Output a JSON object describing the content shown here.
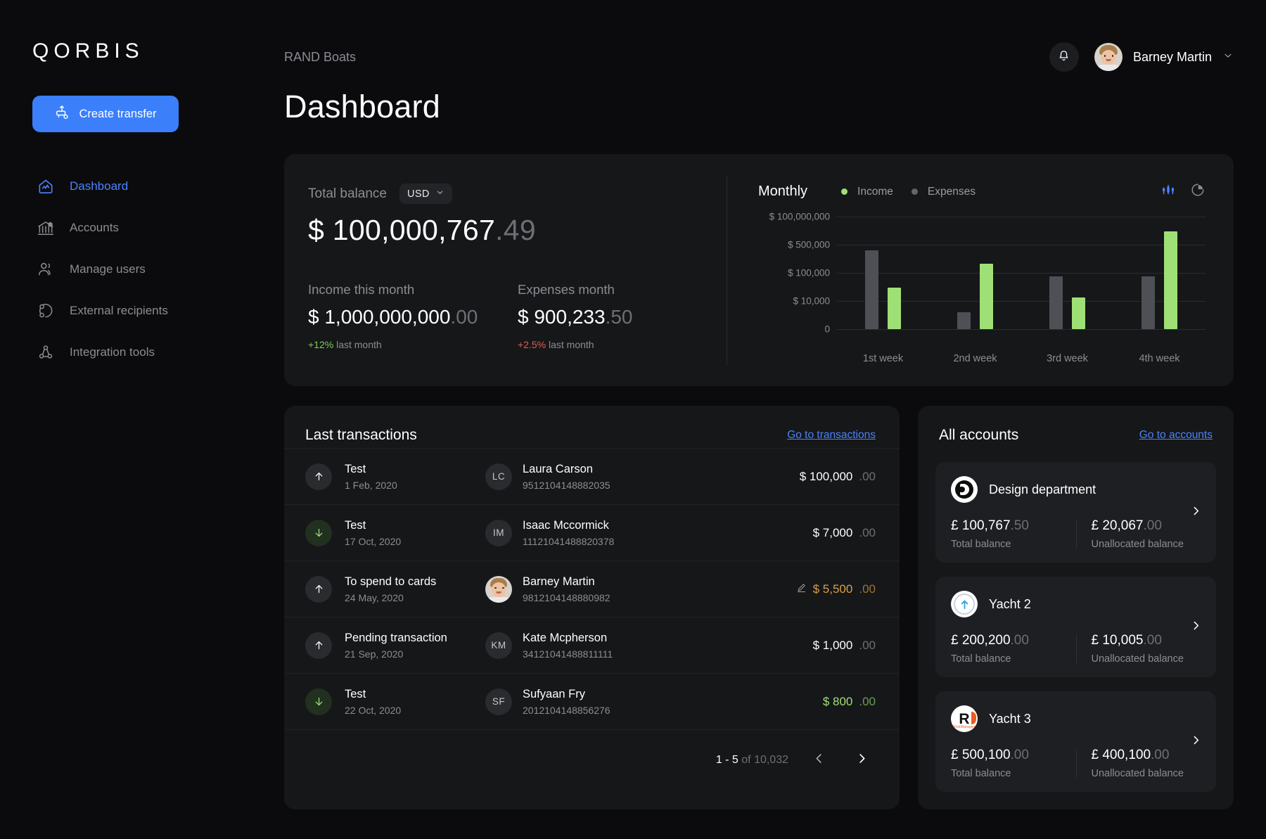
{
  "brand": {
    "logo": "QORBIS"
  },
  "sidebar": {
    "create_button": "Create transfer",
    "items": [
      {
        "label": "Dashboard",
        "icon": "dashboard-house-icon",
        "active": true
      },
      {
        "label": "Accounts",
        "icon": "bank-icon",
        "active": false
      },
      {
        "label": "Manage users",
        "icon": "users-icon",
        "active": false
      },
      {
        "label": "External recipients",
        "icon": "external-recipients-icon",
        "active": false
      },
      {
        "label": "Integration tools",
        "icon": "integration-tools-icon",
        "active": false
      }
    ]
  },
  "topbar": {
    "org_name": "RAND Boats",
    "notifications_icon": "bell-icon",
    "user_name": "Barney Martin",
    "chevron_icon": "chevron-down-icon"
  },
  "page": {
    "title": "Dashboard"
  },
  "summary": {
    "total_balance_label": "Total balance",
    "currency": "USD",
    "currency_chevron": "chevron-down-icon",
    "balance_main": "$ 100,000,767",
    "balance_cents": ".49",
    "income": {
      "label": "Income this month",
      "main": "$ 1,000,000,000",
      "cents": ".00",
      "delta": "+12%",
      "delta_note": "last month"
    },
    "expenses": {
      "label": "Expenses month",
      "main": "$ 900,233",
      "cents": ".50",
      "delta": "+2.5%",
      "delta_note": "last month"
    }
  },
  "chart_panel": {
    "title": "Monthly",
    "legend": [
      {
        "label": "Income",
        "color": "#9fe076"
      },
      {
        "label": "Expenses",
        "color": "#63656a"
      }
    ],
    "toggles": [
      {
        "name": "bar-chart-toggle",
        "active": true,
        "color": "#4b83fb"
      },
      {
        "name": "pie-chart-toggle",
        "active": false,
        "color": "#8b8d93"
      }
    ]
  },
  "chart_data": {
    "type": "bar",
    "title": "Monthly",
    "xlabel": "",
    "ylabel": "",
    "grid": true,
    "legend_position": "top",
    "categories": [
      "1st week",
      "2nd week",
      "3rd week",
      "4th week"
    ],
    "ytick_labels": [
      "$ 100,000,000",
      "$ 500,000",
      "$ 100,000",
      "$ 10,000",
      "0"
    ],
    "ytick_positions_pct": [
      100,
      75,
      50,
      25,
      0
    ],
    "series": [
      {
        "name": "Expenses",
        "color": "#4e5055",
        "values_pct": [
          70,
          15,
          47,
          47
        ]
      },
      {
        "name": "Income",
        "color": "#9fe076",
        "values_pct": [
          37,
          58,
          28,
          87
        ]
      }
    ]
  },
  "transactions": {
    "title": "Last transactions",
    "link": "Go to transactions",
    "rows": [
      {
        "direction": "out",
        "name": "Test",
        "date": "1 Feb, 2020",
        "initials": "LC",
        "party": "Laura Carson",
        "account": "9512104148882035",
        "amount_main": "$ 100,000",
        "amount_cents": ".00",
        "state": "normal",
        "editable": false
      },
      {
        "direction": "in",
        "name": "Test",
        "date": "17 Oct, 2020",
        "initials": "IM",
        "party": "Isaac Mccormick",
        "account": "11121041488820378",
        "amount_main": "$ 7,000",
        "amount_cents": ".00",
        "state": "normal",
        "editable": false
      },
      {
        "direction": "out",
        "name": "To spend to cards",
        "date": "24 May, 2020",
        "initials": "BM",
        "party": "Barney Martin",
        "account": "9812104148880982",
        "amount_main": "$ 5,500",
        "amount_cents": ".00",
        "state": "pending",
        "editable": true,
        "avatar": true
      },
      {
        "direction": "out",
        "name": "Pending transaction",
        "date": "21 Sep, 2020",
        "initials": "KM",
        "party": "Kate Mcpherson",
        "account": "34121041488811111",
        "amount_main": "$ 1,000",
        "amount_cents": ".00",
        "state": "normal",
        "editable": false
      },
      {
        "direction": "in",
        "name": "Test",
        "date": "22 Oct, 2020",
        "initials": "SF",
        "party": "Sufyaan Fry",
        "account": "2012104148856276",
        "amount_main": "$ 800",
        "amount_cents": ".00",
        "state": "credit",
        "editable": false
      }
    ],
    "pager": {
      "range": "1 - 5",
      "of": " of 10,032",
      "prev_icon": "chevron-left-icon",
      "next_icon": "chevron-right-icon"
    }
  },
  "accounts": {
    "title": "All accounts",
    "link": "Go to accounts",
    "total_balance_label": "Total balance",
    "unallocated_label": "Unallocated balance",
    "chevron_icon": "chevron-right-icon",
    "items": [
      {
        "name": "Design department",
        "logo": "design-department-logo",
        "total_main": "£ 100,767",
        "total_cents": ".50",
        "unalloc_main": "£ 20,067",
        "unalloc_cents": ".00"
      },
      {
        "name": "Yacht 2",
        "logo": "yacht2-logo",
        "total_main": "£ 200,200",
        "total_cents": ".00",
        "unalloc_main": "£ 10,005",
        "unalloc_cents": ".00"
      },
      {
        "name": "Yacht 3",
        "logo": "yacht3-logo",
        "total_main": "£ 500,100",
        "total_cents": ".00",
        "unalloc_main": "£ 400,100",
        "unalloc_cents": ".00"
      }
    ]
  }
}
